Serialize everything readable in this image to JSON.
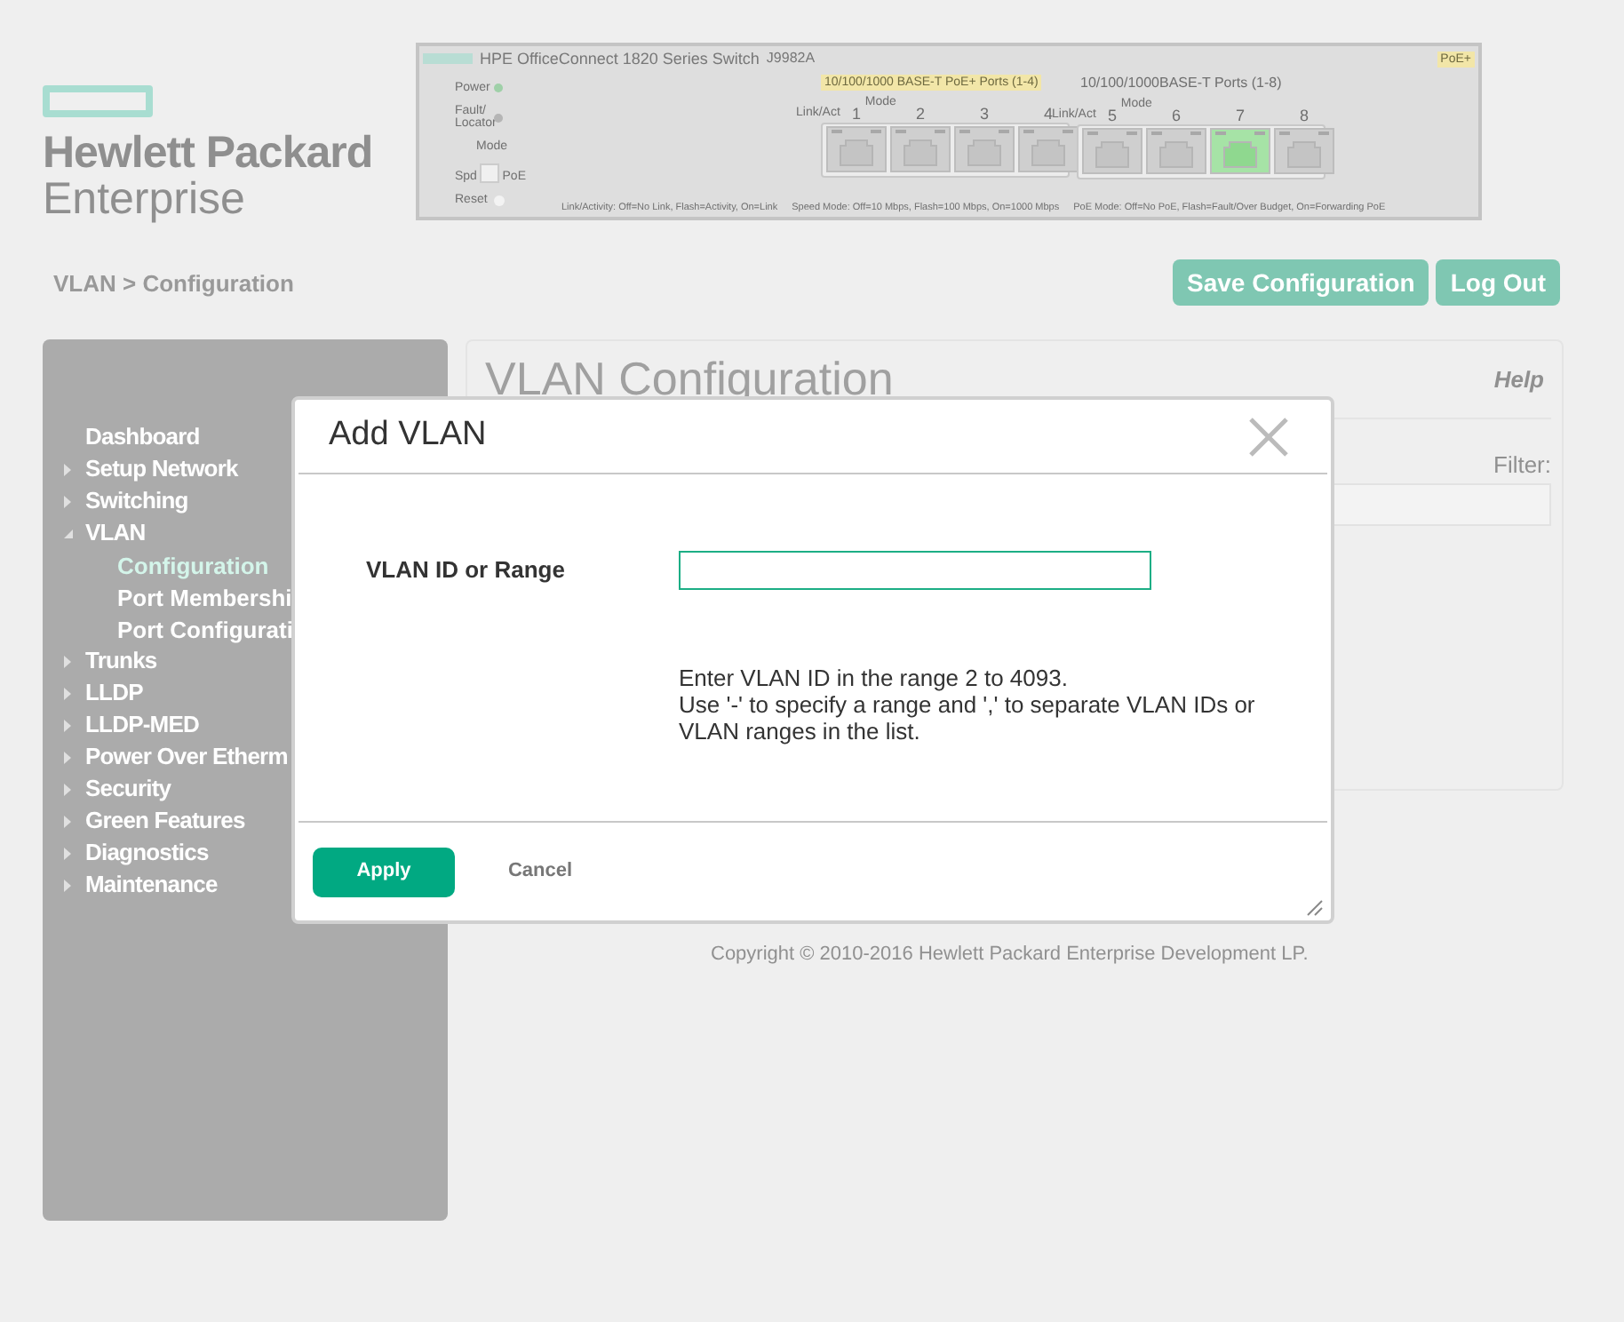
{
  "logo": {
    "line1": "Hewlett Packard",
    "line2": "Enterprise"
  },
  "device_panel": {
    "title": "HPE OfficeConnect 1820 Series Switch",
    "model": "J9982A",
    "badge": "PoE+",
    "leds": [
      {
        "label": "Power",
        "on": true
      },
      {
        "label": "Fault/ Locator",
        "on": false
      }
    ],
    "mode_label": "Mode",
    "mode_options": [
      "Spd",
      "PoE"
    ],
    "reset_label": "Reset",
    "port_groups": [
      {
        "title": "10/100/1000 BASE-T PoE+ Ports (1-4)",
        "highlighted": true,
        "link_label": "Link/Act",
        "mode_label": "Mode",
        "ports": [
          {
            "number": "1",
            "active": false
          },
          {
            "number": "2",
            "active": false
          },
          {
            "number": "3",
            "active": false
          },
          {
            "number": "4",
            "active": false
          }
        ]
      },
      {
        "title": "10/100/1000BASE-T Ports (1-8)",
        "highlighted": false,
        "link_label": "Link/Act",
        "mode_label": "Mode",
        "ports": [
          {
            "number": "5",
            "active": false
          },
          {
            "number": "6",
            "active": false
          },
          {
            "number": "7",
            "active": true
          },
          {
            "number": "8",
            "active": false
          }
        ]
      }
    ],
    "legends": [
      "Link/Activity: Off=No Link, Flash=Activity, On=Link",
      "Speed Mode: Off=10 Mbps, Flash=100 Mbps, On=1000 Mbps",
      "PoE Mode: Off=No PoE, Flash=Fault/Over Budget, On=Forwarding PoE"
    ]
  },
  "breadcrumb": "VLAN > Configuration",
  "header_buttons": [
    "Save Configuration",
    "Log Out"
  ],
  "sidebar": {
    "items": [
      {
        "label": "Dashboard"
      },
      {
        "label": "Setup Network",
        "expandable": true,
        "expanded": false
      },
      {
        "label": "Switching",
        "expandable": true,
        "expanded": false
      },
      {
        "label": "VLAN",
        "expandable": true,
        "expanded": true,
        "children": [
          {
            "label": "Configuration",
            "selected": true
          },
          {
            "label": "Port Membershi",
            "selected": false
          },
          {
            "label": "Port Configurati",
            "selected": false
          }
        ]
      },
      {
        "label": "Trunks",
        "expandable": true,
        "expanded": false
      },
      {
        "label": "LLDP",
        "expandable": true,
        "expanded": false
      },
      {
        "label": "LLDP-MED",
        "expandable": true,
        "expanded": false
      },
      {
        "label": "Power Over Etherm",
        "expandable": true,
        "expanded": false
      },
      {
        "label": "Security",
        "expandable": true,
        "expanded": false
      },
      {
        "label": "Green Features",
        "expandable": true,
        "expanded": false
      },
      {
        "label": "Diagnostics",
        "expandable": true,
        "expanded": false
      },
      {
        "label": "Maintenance",
        "expandable": true,
        "expanded": false
      }
    ]
  },
  "content": {
    "title": "VLAN Configuration",
    "help": "Help",
    "filter_label": "Filter:"
  },
  "copyright": "Copyright © 2010-2016 Hewlett Packard Enterprise Development LP.",
  "dialog": {
    "title": "Add VLAN",
    "field_label": "VLAN ID or Range",
    "hint_lines": [
      "Enter VLAN ID in the range 2 to 4093.",
      "Use '-' to specify a range and ',' to separate VLAN IDs or VLAN ranges in the list."
    ],
    "buttons": [
      {
        "label": "Apply",
        "kind": "primary"
      },
      {
        "label": "Cancel",
        "kind": "secondary"
      }
    ]
  }
}
